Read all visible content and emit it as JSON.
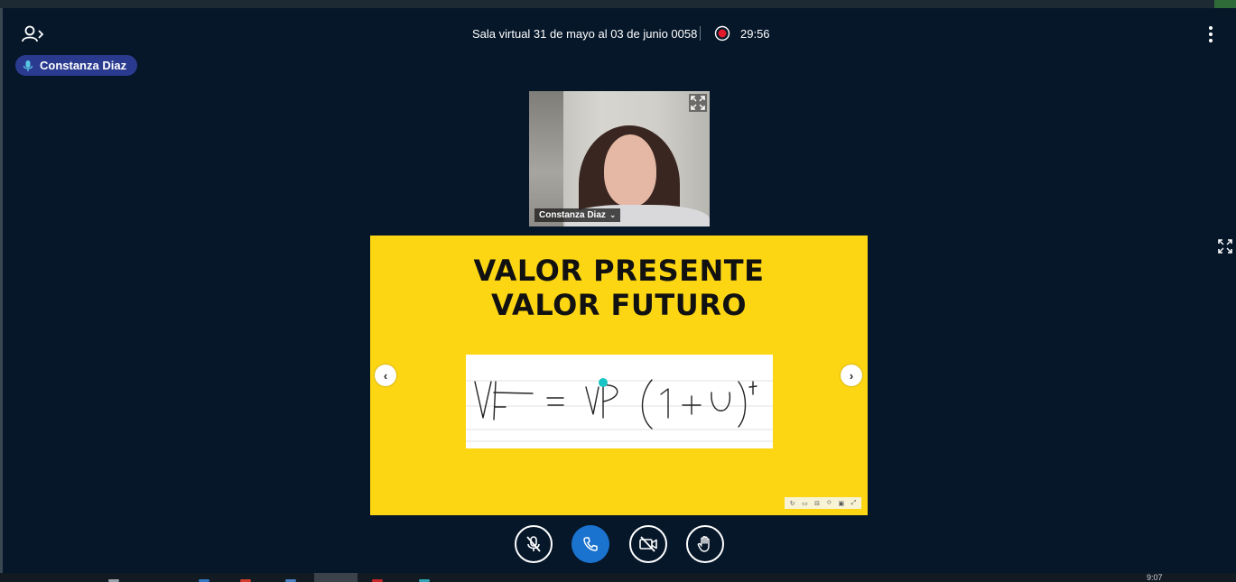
{
  "session": {
    "title": "Sala virtual 31 de mayo al 03 de junio 0058",
    "timer": "29:56"
  },
  "talker": {
    "name": "Constanza Diaz"
  },
  "webcam": {
    "name": "Constanza Diaz",
    "chevron": "⌄"
  },
  "slide": {
    "title_line1": "VALOR PRESENTE",
    "title_line2": "VALOR FUTURO",
    "prev_arrow": "‹",
    "next_arrow": "›",
    "tools": [
      "↻",
      "▭",
      "⊟",
      "⟐",
      "▣",
      "⤢"
    ]
  },
  "taskbar": {
    "clock": "9:07"
  },
  "colors": {
    "background": "#06172a",
    "slide_yellow": "#fdd613",
    "talker_pill": "#2a3b8f",
    "recording": "#e0192a",
    "phone_button": "#1b73d0"
  },
  "icons": {
    "users_toggle": "user-arrow-icon",
    "recording": "record-icon",
    "options": "kebab-icon",
    "mute": "mic-muted-icon",
    "leave": "phone-icon",
    "camera": "camera-off-icon",
    "raise_hand": "hand-icon",
    "fullscreen": "expand-icon"
  }
}
